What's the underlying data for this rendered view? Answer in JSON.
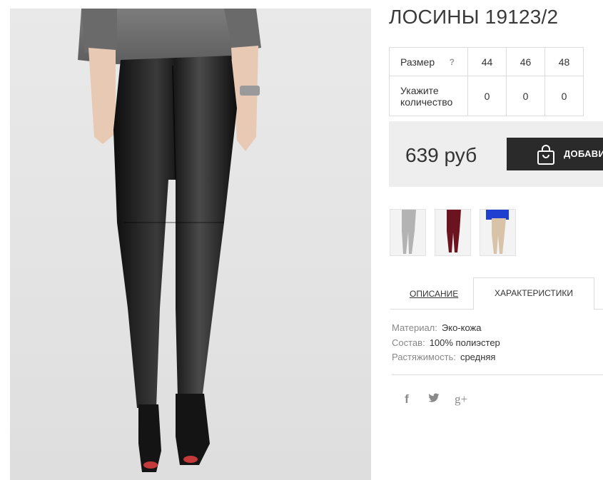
{
  "product": {
    "title": "ЛОСИНЫ 19123/2",
    "price": "639 руб"
  },
  "sizes": {
    "size_label": "Размер",
    "help": "?",
    "qty_label_1": "Укажите",
    "qty_label_2": "количество",
    "values": [
      "44",
      "46",
      "48"
    ],
    "quantities": [
      "0",
      "0",
      "0"
    ]
  },
  "cart": {
    "label": "ДОБАВИТЬ В КОРЗИНУ",
    "icon": "shopping-bag-icon"
  },
  "thumbnails": [
    {
      "icon": "thumbnail-silver-leggings",
      "color": "#b9b9b9"
    },
    {
      "icon": "thumbnail-burgundy-leggings",
      "color": "#6b1420"
    },
    {
      "icon": "thumbnail-beige-leggings",
      "color": "#d9c3a8"
    }
  ],
  "tabs": {
    "description": "ОПИСАНИЕ",
    "characteristics": "ХАРАКТЕРИСТИКИ"
  },
  "specs": [
    {
      "key": "Материал:",
      "value": "Эко-кожа"
    },
    {
      "key": "Состав:",
      "value": "100% полиэстер"
    },
    {
      "key": "Растяжимость:",
      "value": "средняя"
    }
  ],
  "social": {
    "facebook": "f",
    "twitter": "twitter-icon",
    "google_plus": "g+"
  },
  "colors": {
    "button_bg": "#2a2a2a",
    "price_bg": "#eeeeee",
    "border": "#dcdcdc"
  }
}
